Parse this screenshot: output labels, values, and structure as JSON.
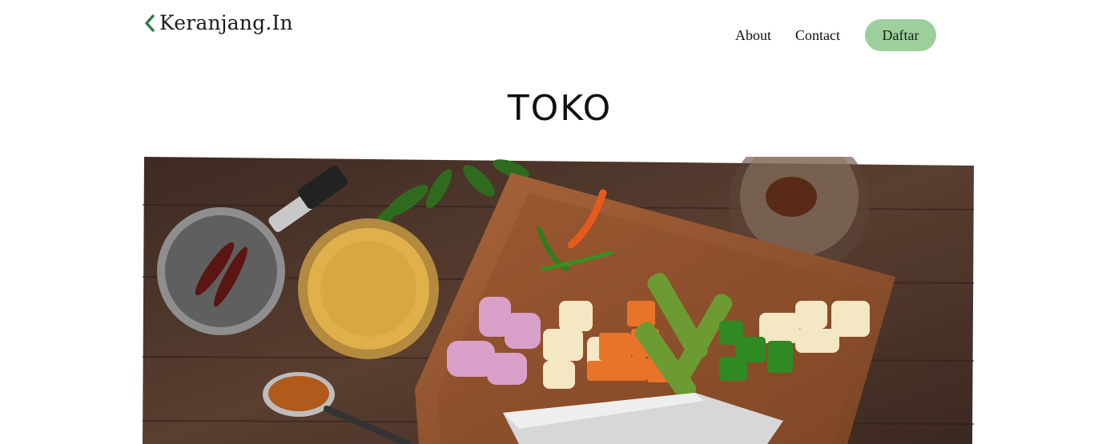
{
  "header": {
    "brand": "Keranjang.In",
    "brand_icon": "chevron-left-icon",
    "accent_color": "#2f7d4a"
  },
  "nav": {
    "about": "About",
    "contact": "Contact",
    "daftar": "Daftar",
    "button_color": "#9ccf9b"
  },
  "page": {
    "title": "TOKO"
  },
  "hero": {
    "subject": "hero-image-cutting-board-with-chopped-vegetables"
  }
}
